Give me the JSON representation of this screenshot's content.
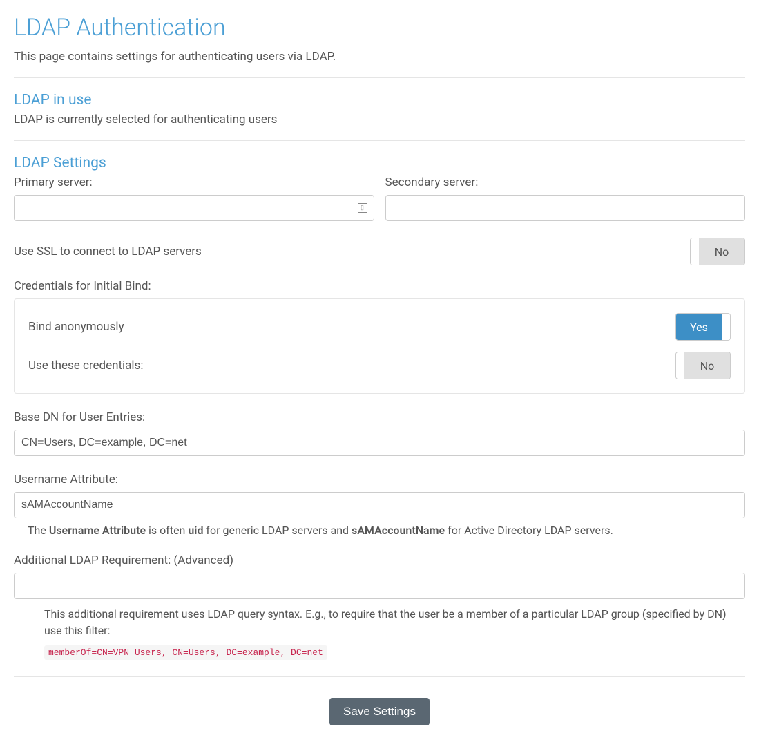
{
  "page": {
    "title": "LDAP Authentication",
    "subtitle": "This page contains settings for authenticating users via LDAP."
  },
  "inuse": {
    "heading": "LDAP in use",
    "desc": "LDAP is currently selected for authenticating users"
  },
  "settings": {
    "heading": "LDAP Settings",
    "primary_label": "Primary server:",
    "primary_value": "",
    "secondary_label": "Secondary server:",
    "secondary_value": "",
    "ssl_label": "Use SSL to connect to LDAP servers",
    "ssl_toggle": "No",
    "credentials_label": "Credentials for Initial Bind:",
    "bind_anon_label": "Bind anonymously",
    "bind_anon_toggle": "Yes",
    "use_creds_label": "Use these credentials:",
    "use_creds_toggle": "No",
    "basedn_label": "Base DN for User Entries:",
    "basedn_placeholder": "CN=Users, DC=example, DC=net",
    "basedn_value": "",
    "username_attr_label": "Username Attribute:",
    "username_attr_placeholder": "sAMAccountName",
    "username_attr_value": "",
    "username_help_pre": "The ",
    "username_help_strong1": "Username Attribute",
    "username_help_mid1": " is often ",
    "username_help_strong2": "uid",
    "username_help_mid2": " for generic LDAP servers and ",
    "username_help_strong3": "sAMAccountName",
    "username_help_post": " for Active Directory LDAP servers.",
    "additional_label": "Additional LDAP Requirement: (Advanced)",
    "additional_value": "",
    "additional_help": "This additional requirement uses LDAP query syntax. E.g., to require that the user be a member of a particular LDAP group (specified by DN) use this filter:",
    "additional_code": "memberOf=CN=VPN Users, CN=Users, DC=example, DC=net"
  },
  "actions": {
    "save": "Save Settings"
  }
}
